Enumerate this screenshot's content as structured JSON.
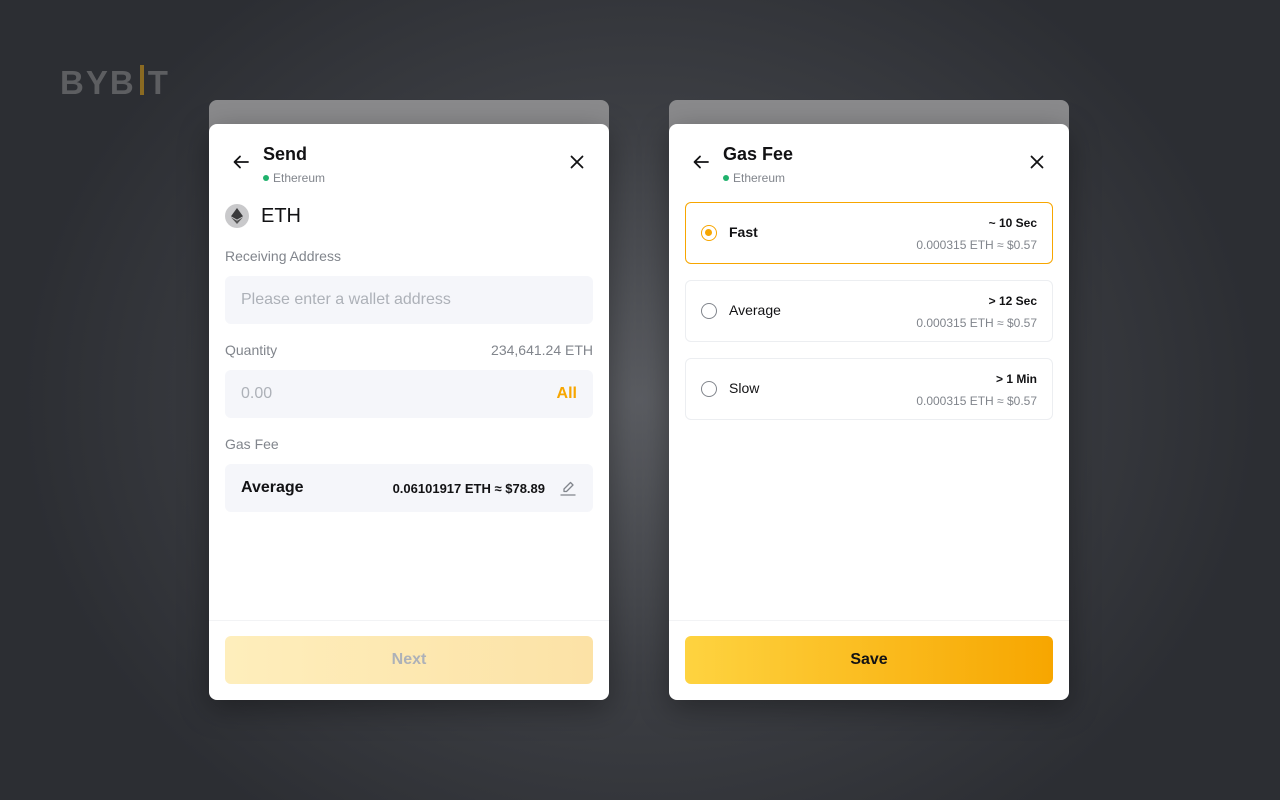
{
  "brand": {
    "logo_left": "BYB",
    "logo_right": "T",
    "accent": "#f7a600"
  },
  "send_panel": {
    "title": "Send",
    "network": "Ethereum",
    "coin": {
      "symbol": "ETH",
      "icon": "ethereum-icon"
    },
    "receiving_address": {
      "label": "Receiving Address",
      "value": "",
      "placeholder": "Please enter a wallet address"
    },
    "quantity": {
      "label": "Quantity",
      "balance": "234,641.24 ETH",
      "value": "",
      "placeholder": "0.00",
      "all_label": "All"
    },
    "gas_fee": {
      "label": "Gas Fee",
      "selected": "Average",
      "value": "0.06101917 ETH ≈ $78.89",
      "edit_icon": "pencil-icon"
    },
    "next_label": "Next"
  },
  "gas_panel": {
    "title": "Gas Fee",
    "network": "Ethereum",
    "options": [
      {
        "name": "Fast",
        "time": "~ 10 Sec",
        "cost": "0.000315 ETH ≈ $0.57",
        "selected": true
      },
      {
        "name": "Average",
        "time": "> 12 Sec",
        "cost": "0.000315 ETH ≈ $0.57",
        "selected": false
      },
      {
        "name": "Slow",
        "time": "> 1 Min",
        "cost": "0.000315 ETH ≈ $0.57",
        "selected": false
      }
    ],
    "save_label": "Save"
  }
}
